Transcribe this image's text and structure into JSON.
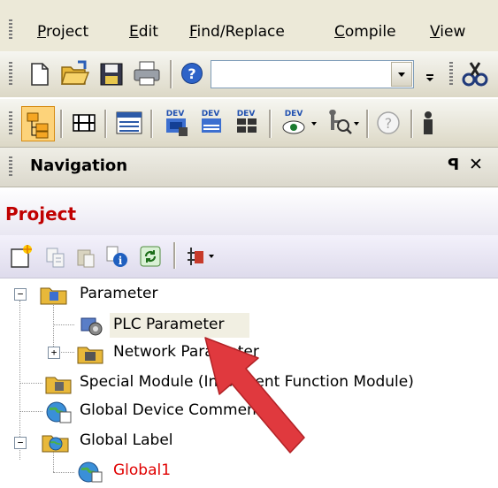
{
  "menu": {
    "items": [
      {
        "pre": "",
        "key": "P",
        "post": "roject"
      },
      {
        "pre": "",
        "key": "E",
        "post": "dit"
      },
      {
        "pre": "",
        "key": "F",
        "post": "ind/Replace"
      },
      {
        "pre": "",
        "key": "C",
        "post": "ompile"
      },
      {
        "pre": "",
        "key": "V",
        "post": "iew"
      }
    ]
  },
  "toolbar": {
    "combo_value": "",
    "dev_label": "DEV"
  },
  "navigation": {
    "title": "Navigation",
    "pin_glyph": "ꟼ",
    "close_glyph": "✕"
  },
  "project": {
    "title": "Project"
  },
  "tree": {
    "parameter": "Parameter",
    "plc_parameter": "PLC Parameter",
    "network_parameter": "Network Parameter",
    "special_module": "Special Module (Intelligent Function Module)",
    "global_device_comment": "Global Device Comment",
    "global_label": "Global Label",
    "global1": "Global1",
    "expand_minus": "−",
    "expand_plus": "+"
  },
  "colors": {
    "project_title": "#c00000",
    "global1_text": "#e00000",
    "arrow": "#e0393e"
  }
}
